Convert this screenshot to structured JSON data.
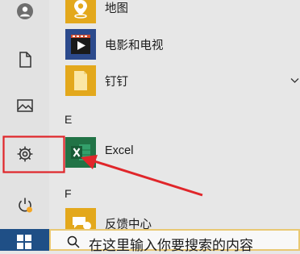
{
  "sidebar": {
    "items": [
      {
        "icon": "user-icon"
      },
      {
        "icon": "document-icon"
      },
      {
        "icon": "pictures-icon"
      },
      {
        "icon": "settings-icon",
        "highlighted": true
      },
      {
        "icon": "power-icon"
      }
    ]
  },
  "apps": [
    {
      "label": "地图",
      "icon": "maps-icon",
      "tile_color": "#e3a81c"
    },
    {
      "label": "电影和电视",
      "icon": "movies-tv-icon",
      "tile_color": "#2c4a8c"
    },
    {
      "label": "钉钉",
      "icon": "folder-icon",
      "tile_color": "#e3a81c"
    },
    {
      "label": "Excel",
      "icon": "excel-icon",
      "tile_color": "#217346"
    },
    {
      "label": "反馈中心",
      "icon": "feedback-hub-icon",
      "tile_color": "#e3a81c"
    }
  ],
  "sections": {
    "e": "E",
    "f": "F"
  },
  "search": {
    "text": "在这里输入你要搜索的内容",
    "icon": "search-icon"
  },
  "taskbar": {
    "start_icon": "windows-logo-icon"
  },
  "annotations": {
    "highlight_color": "#e0262a",
    "arrow_color": "#e0262a"
  }
}
